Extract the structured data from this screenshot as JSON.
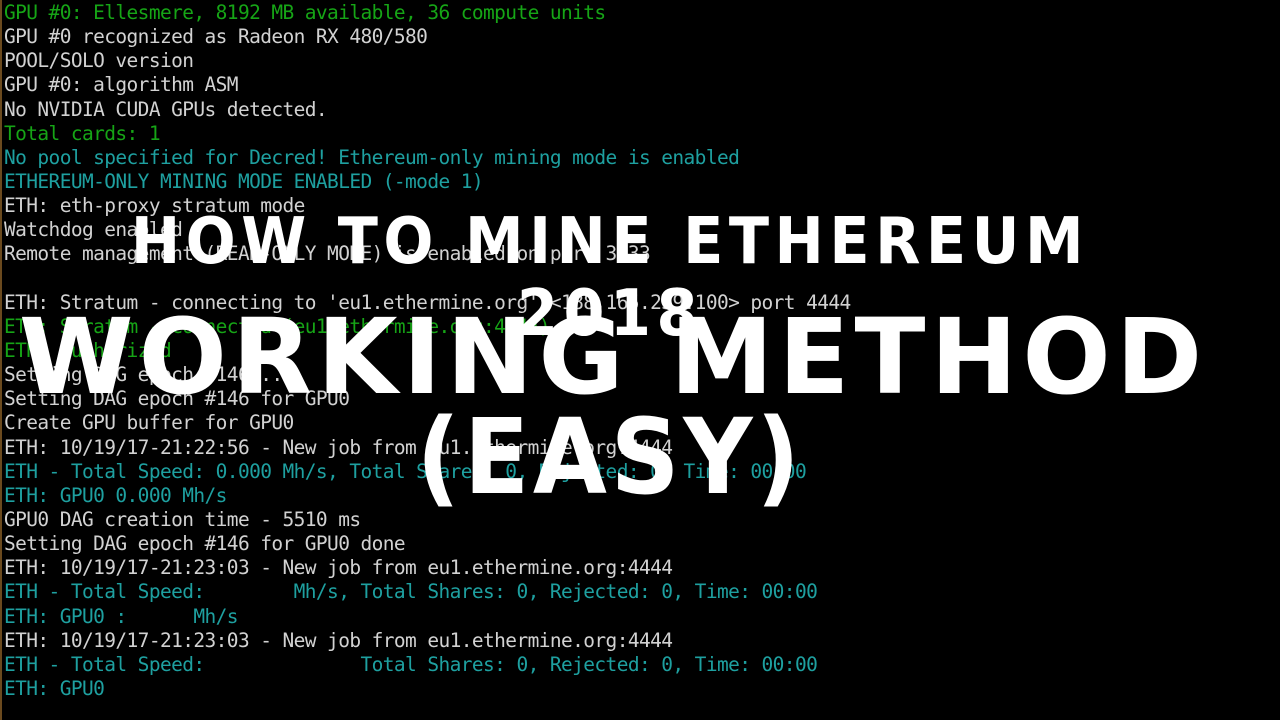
{
  "console": {
    "colors": {
      "white": "#d2d2d2",
      "green": "#16a516",
      "cyan": "#1ea0a0",
      "background": "#000000"
    },
    "lines": [
      {
        "text": "GPU #0: Ellesmere, 8192 MB available, 36 compute units",
        "color": "green"
      },
      {
        "text": "GPU #0 recognized as Radeon RX 480/580",
        "color": "white"
      },
      {
        "text": "POOL/SOLO version",
        "color": "white"
      },
      {
        "text": "GPU #0: algorithm ASM",
        "color": "white"
      },
      {
        "text": "No NVIDIA CUDA GPUs detected.",
        "color": "white"
      },
      {
        "text": "Total cards: 1",
        "color": "green"
      },
      {
        "text": "No pool specified for Decred! Ethereum-only mining mode is enabled",
        "color": "cyan"
      },
      {
        "text": "ETHEREUM-ONLY MINING MODE ENABLED (-mode 1)",
        "color": "cyan"
      },
      {
        "text": "ETH: eth-proxy stratum mode",
        "color": "white"
      },
      {
        "text": "Watchdog enabled",
        "color": "white"
      },
      {
        "text": "Remote management (READ-ONLY MODE) is enabled on port 3333",
        "color": "white"
      },
      {
        "text": "",
        "color": "white"
      },
      {
        "text": "ETH: Stratum - connecting to 'eu1.ethermine.org' <188.165.239.100> port 4444",
        "color": "white"
      },
      {
        "text": "ETH: Stratum - Connected (eu1.ethermine.org:4444)",
        "color": "green"
      },
      {
        "text": "ETH: Authorized",
        "color": "green"
      },
      {
        "text": "Setting DAG epoch #146...",
        "color": "white"
      },
      {
        "text": "Setting DAG epoch #146 for GPU0",
        "color": "white"
      },
      {
        "text": "Create GPU buffer for GPU0",
        "color": "white"
      },
      {
        "text": "ETH: 10/19/17-21:22:56 - New job from eu1.ethermine.org:4444",
        "color": "white"
      },
      {
        "text": "ETH - Total Speed: 0.000 Mh/s, Total Shares: 0, Rejected: 0, Time: 00:00",
        "color": "cyan"
      },
      {
        "text": "ETH: GPU0 0.000 Mh/s",
        "color": "cyan"
      },
      {
        "text": "GPU0 DAG creation time - 5510 ms",
        "color": "white"
      },
      {
        "text": "Setting DAG epoch #146 for GPU0 done",
        "color": "white"
      },
      {
        "text": "ETH: 10/19/17-21:23:03 - New job from eu1.ethermine.org:4444",
        "color": "white"
      },
      {
        "text": "ETH - Total Speed:        Mh/s, Total Shares: 0, Rejected: 0, Time: 00:00",
        "color": "cyan"
      },
      {
        "text": "ETH: GPU0 :      Mh/s",
        "color": "cyan"
      },
      {
        "text": "ETH: 10/19/17-21:23:03 - New job from eu1.ethermine.org:4444",
        "color": "white"
      },
      {
        "text": "ETH - Total Speed:              Total Shares: 0, Rejected: 0, Time: 00:00",
        "color": "cyan"
      },
      {
        "text": "ETH: GPU0",
        "color": "cyan"
      }
    ]
  },
  "overlay": {
    "line1": "HOW TO MINE ETHEREUM 2018",
    "line2": "WORKING METHOD",
    "line3": "(EASY)",
    "color": "#ffffff"
  }
}
